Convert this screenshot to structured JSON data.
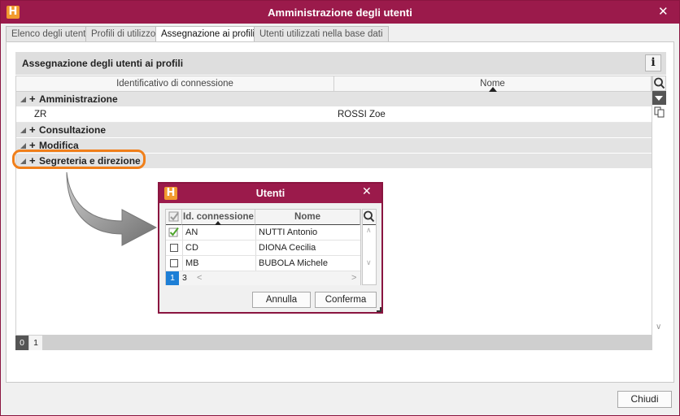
{
  "window": {
    "title": "Amministrazione degli utenti",
    "logo_letter": "H",
    "close_glyph": "✕"
  },
  "tabs": [
    {
      "label": "Elenco degli utenti",
      "active": false
    },
    {
      "label": "Profili di utilizzo",
      "active": false
    },
    {
      "label": "Assegnazione ai profili",
      "active": true
    },
    {
      "label": "Utenti utilizzati nella base dati",
      "active": false
    }
  ],
  "panel": {
    "title": "Assegnazione degli utenti ai profili",
    "info_glyph": "i"
  },
  "grid": {
    "columns": [
      "Identificativo di connessione",
      "Nome"
    ],
    "groups": [
      {
        "label": "Amministrazione",
        "rows": [
          {
            "id": "ZR",
            "name": "ROSSI Zoe"
          }
        ]
      },
      {
        "label": "Consultazione",
        "rows": []
      },
      {
        "label": "Modifica",
        "rows": []
      },
      {
        "label": "Segreteria e direzione",
        "rows": []
      }
    ],
    "plus_glyph": "+",
    "pages": [
      "0",
      "1"
    ]
  },
  "dialog": {
    "title": "Utenti",
    "logo_letter": "H",
    "close_glyph": "✕",
    "columns": [
      "Id. connessione",
      "Nome"
    ],
    "rows": [
      {
        "id": "AN",
        "name": "NUTTI Antonio",
        "checked": true
      },
      {
        "id": "CD",
        "name": "DIONA Cecilia",
        "checked": false
      },
      {
        "id": "MB",
        "name": "BUBOLA Michele",
        "checked": false
      }
    ],
    "page": "1",
    "count": "3",
    "left_glyph": "<",
    "right_glyph": ">",
    "cancel_label": "Annulla",
    "confirm_label": "Conferma"
  },
  "footer": {
    "close_label": "Chiudi"
  },
  "colors": {
    "title_bar": "#9b1a4b",
    "logo": "#f29a2e",
    "highlight": "#f07f1a",
    "page_active": "#1d7fd6"
  }
}
